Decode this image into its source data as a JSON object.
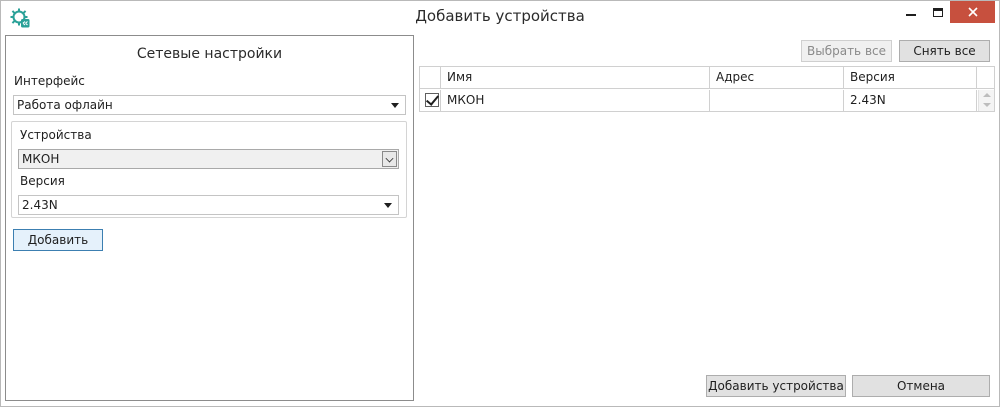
{
  "window": {
    "title": "Добавить устройства"
  },
  "network_settings": {
    "title": "Сетевые настройки",
    "interface_label": "Интерфейс",
    "interface_value": "Работа офлайн",
    "devices_label": "Устройства",
    "devices_value": "МКОН",
    "version_label": "Версия",
    "version_value": "2.43N",
    "add_button": "Добавить"
  },
  "toolbar": {
    "select_all": "Выбрать все",
    "deselect_all": "Снять все"
  },
  "grid": {
    "columns": [
      "Имя",
      "Адрес",
      "Версия"
    ],
    "rows": [
      {
        "checked": true,
        "name": "МКОН",
        "address": "",
        "version": "2.43N"
      }
    ]
  },
  "footer": {
    "add_devices": "Добавить устройства",
    "cancel": "Отмена"
  },
  "colors": {
    "close_button": "#c7503e",
    "accent": "#3c7fb1",
    "app_icon": "#2aa198"
  },
  "icons": {
    "app": "gear-plus-icon",
    "minimize": "minimize-icon",
    "maximize": "maximize-icon",
    "close": "close-icon"
  }
}
